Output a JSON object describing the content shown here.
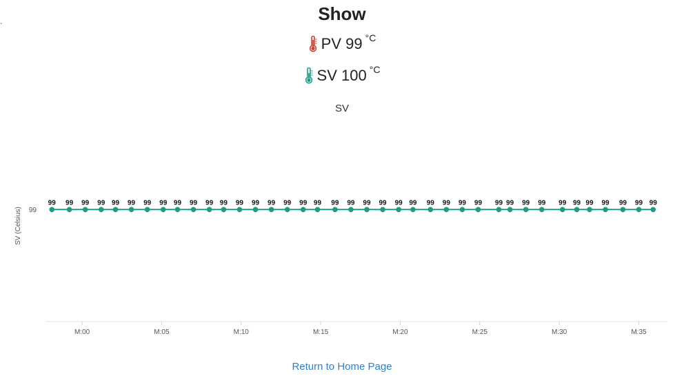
{
  "page": {
    "title": "Show",
    "stray_mark": "`",
    "pv": {
      "label": "PV",
      "value": "99",
      "unit": "°C",
      "icon": "thermometer-hot-icon",
      "icon_color": "#c9432f"
    },
    "sv": {
      "label": "SV",
      "value": "100",
      "unit": "°C",
      "icon": "thermometer-icon",
      "icon_color": "#1b9c86"
    },
    "home_link": "Return to Home Page",
    "link_color": "#2a7fd4"
  },
  "chart_data": {
    "type": "line",
    "title": "SV",
    "ylabel": "SV (Celsius)",
    "xlabel": "",
    "x_tick_labels": [
      "M:00",
      "M:05",
      "M:10",
      "M:15",
      "M:20",
      "M:25",
      "M:30",
      "M:35"
    ],
    "x_tick_minutes": [
      0,
      5,
      10,
      15,
      20,
      25,
      30,
      35
    ],
    "y_tick_labels": [
      "99"
    ],
    "xlim": [
      -2.3,
      36.8
    ],
    "ylim": [
      98.25,
      99.55
    ],
    "grid": false,
    "color": "#1a9c86",
    "series": [
      {
        "x": [
          -1.9,
          -0.8,
          0.2,
          1.2,
          2.1,
          3.1,
          4.1,
          5.1,
          6.0,
          7.0,
          8.0,
          8.9,
          9.9,
          10.9,
          11.9,
          12.9,
          13.9,
          14.8,
          15.9,
          16.9,
          17.9,
          18.9,
          19.9,
          20.8,
          21.9,
          22.9,
          23.9,
          24.9,
          26.2,
          26.9,
          27.9,
          28.9,
          30.2,
          31.1,
          31.9,
          32.9,
          34.0,
          35.0,
          35.9
        ],
        "y": [
          99,
          99,
          99,
          99,
          99,
          99,
          99,
          99,
          99,
          99,
          99,
          99,
          99,
          99,
          99,
          99,
          99,
          99,
          99,
          99,
          99,
          99,
          99,
          99,
          99,
          99,
          99,
          99,
          99,
          99,
          99,
          99,
          99,
          99,
          99,
          99,
          99,
          99,
          99
        ],
        "data_labels": [
          "99",
          "99",
          "99",
          "99",
          "99",
          "99",
          "99",
          "99",
          "99",
          "99",
          "99",
          "99",
          "99",
          "99",
          "99",
          "99",
          "99",
          "99",
          "99",
          "99",
          "99",
          "99",
          "99",
          "99",
          "99",
          "99",
          "99",
          "99",
          "99",
          "99",
          "99",
          "99",
          "99",
          "99",
          "99",
          "99",
          "99",
          "99",
          "99"
        ]
      }
    ]
  }
}
